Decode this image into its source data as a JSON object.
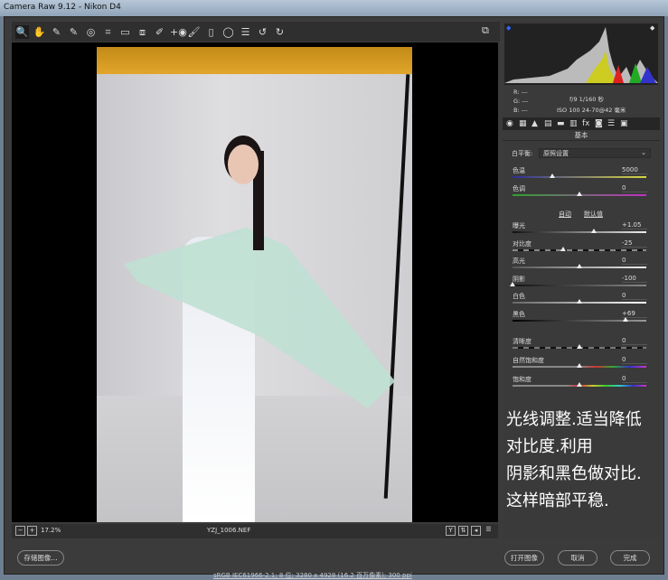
{
  "window": {
    "title": "Camera Raw 9.12 -  Nikon D4"
  },
  "toolbar": {
    "tools": [
      "zoom-icon",
      "hand-icon",
      "white-balance-icon",
      "color-sampler-icon",
      "targeted-adjustment-icon",
      "crop-icon",
      "straighten-icon",
      "transform-icon",
      "spot-removal-icon",
      "red-eye-icon",
      "adjustment-brush-icon",
      "graduated-filter-icon",
      "radial-filter-icon",
      "preferences-icon",
      "rotate-left-icon",
      "rotate-right-icon"
    ],
    "glyphs": [
      "🔍",
      "✋",
      "✎",
      "✎",
      "◎",
      "⌗",
      "▭",
      "⧈",
      "✐",
      "+◉",
      "🖌",
      "▯",
      "◯",
      "☰",
      "↺",
      "↻"
    ]
  },
  "info": {
    "r": "R:  ---",
    "g": "G:  ---",
    "b": "B:  ---",
    "exposure": "f/9   1/160 秒",
    "lens": "ISO 100   24-70@42 毫米"
  },
  "panel": {
    "section_title": "基本",
    "tabs": [
      "◉",
      "▦",
      "▲",
      "▤",
      "▬",
      "▥",
      "fx",
      "◙",
      "☰",
      "▣"
    ],
    "white_balance_label": "白平衡:",
    "white_balance_value": "原照设置",
    "auto": "自动",
    "default": "默认值",
    "sliders": [
      {
        "label": "色温",
        "value": "5000",
        "fraction": 0.3,
        "track": "linear-gradient(90deg,#2d2d9a,#d8d840)"
      },
      {
        "label": "色调",
        "value": "0",
        "fraction": 0.5,
        "track": "linear-gradient(90deg,#2fa02f,#c030c0)"
      },
      {
        "label": "曝光",
        "value": "+1.05",
        "fraction": 0.605,
        "track": "linear-gradient(90deg,#111,#eee)"
      },
      {
        "label": "对比度",
        "value": "-25",
        "fraction": 0.375,
        "track": "repeating-linear-gradient(90deg,#888 0 6px,#111 6px 12px)"
      },
      {
        "label": "高光",
        "value": "0",
        "fraction": 0.5,
        "track": "linear-gradient(90deg,#555,#eee)"
      },
      {
        "label": "阴影",
        "value": "-100",
        "fraction": 0,
        "track": "linear-gradient(90deg,#111,#888)"
      },
      {
        "label": "白色",
        "value": "0",
        "fraction": 0.5,
        "track": "linear-gradient(90deg,#666,#fff)"
      },
      {
        "label": "黑色",
        "value": "+69",
        "fraction": 0.845,
        "track": "linear-gradient(90deg,#000,#999)"
      },
      {
        "label": "清晰度",
        "value": "0",
        "fraction": 0.5,
        "track": "repeating-linear-gradient(90deg,#777 0 6px,#111 6px 12px)"
      },
      {
        "label": "自然饱和度",
        "value": "0",
        "fraction": 0.5,
        "track": "linear-gradient(90deg,#888,#888 50%,#c33,#3a3,#33c,#c3c)"
      },
      {
        "label": "饱和度",
        "value": "0",
        "fraction": 0.5,
        "track": "linear-gradient(90deg,#888,#888 40%,#c33,#cc3,#3c3,#3cc,#33c,#c3c)"
      }
    ]
  },
  "viewer": {
    "zoom": "17.2%",
    "filename": "YZJ_1006.NEF"
  },
  "overlay_text": "光线调整.适当降低\n对比度.利用\n阴影和黑色做对比.\n这样暗部平稳.",
  "footer": {
    "save": "存储图像...",
    "specs": "sRGB IEC61966-2.1; 8 位; 3280 x 4928 (16.2 百万像素); 300 ppi",
    "open": "打开图像",
    "cancel": "取消",
    "done": "完成"
  }
}
